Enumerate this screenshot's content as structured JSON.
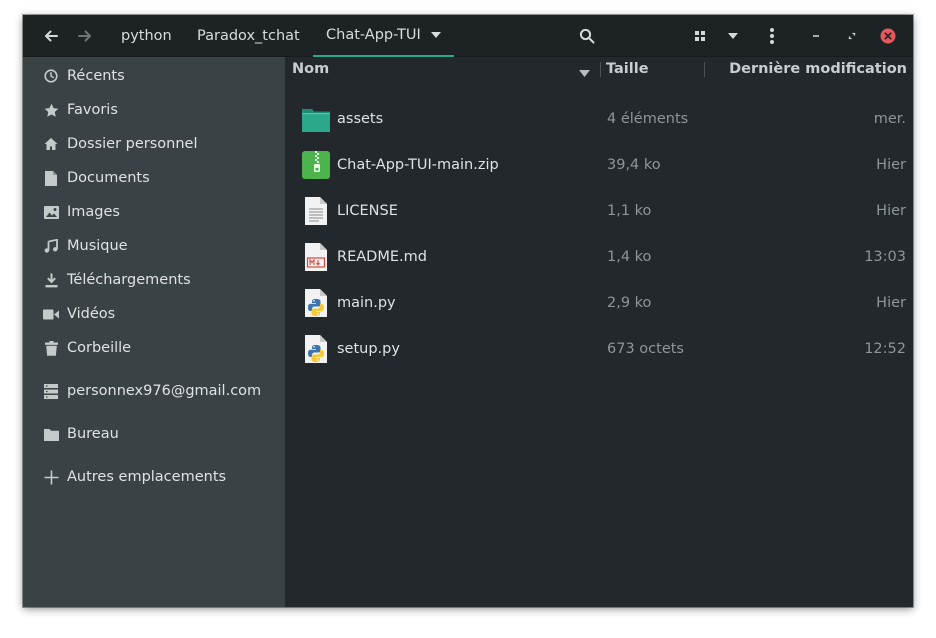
{
  "breadcrumbs": [
    "python",
    "Paradox_tchat",
    "Chat-App-TUI"
  ],
  "sidebar": {
    "items": [
      {
        "label": "Récents",
        "icon": "clock-icon"
      },
      {
        "label": "Favoris",
        "icon": "star-icon"
      },
      {
        "label": "Dossier personnel",
        "icon": "home-icon"
      },
      {
        "label": "Documents",
        "icon": "document-icon"
      },
      {
        "label": "Images",
        "icon": "image-icon"
      },
      {
        "label": "Musique",
        "icon": "music-icon"
      },
      {
        "label": "Téléchargements",
        "icon": "download-icon"
      },
      {
        "label": "Vidéos",
        "icon": "video-icon"
      },
      {
        "label": "Corbeille",
        "icon": "trash-icon"
      }
    ],
    "account": {
      "label": "personnex976@gmail.com",
      "icon": "server-icon"
    },
    "bookmark": {
      "label": "Bureau",
      "icon": "folder-icon"
    },
    "other": {
      "label": "Autres emplacements",
      "icon": "plus-icon"
    }
  },
  "columns": {
    "name": "Nom",
    "size": "Taille",
    "modified": "Dernière modification"
  },
  "files": [
    {
      "name": "assets",
      "size": "4 éléments",
      "modified": "mer.",
      "icon": "folder-icon"
    },
    {
      "name": "Chat-App-TUI-main.zip",
      "size": "39,4 ko",
      "modified": "Hier",
      "icon": "archive-icon"
    },
    {
      "name": "LICENSE",
      "size": "1,1 ko",
      "modified": "Hier",
      "icon": "text-file-icon"
    },
    {
      "name": "README.md",
      "size": "1,4 ko",
      "modified": "13:03",
      "icon": "markdown-file-icon"
    },
    {
      "name": "main.py",
      "size": "2,9 ko",
      "modified": "Hier",
      "icon": "python-file-icon"
    },
    {
      "name": "setup.py",
      "size": "673 octets",
      "modified": "12:52",
      "icon": "python-file-icon"
    }
  ],
  "colors": {
    "accent": "#2aa889",
    "sidebar_bg": "#3b4245",
    "main_bg": "#22282b",
    "header_bg": "#1d2225",
    "close_button": "#e8585e"
  }
}
